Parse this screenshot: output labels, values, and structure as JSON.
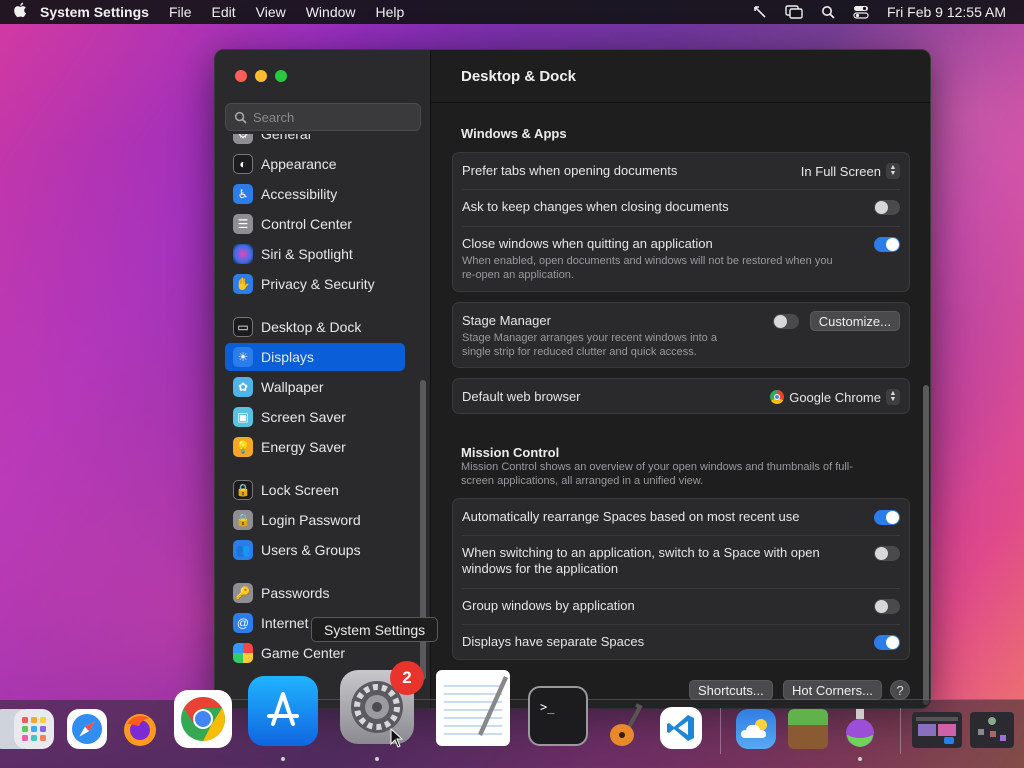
{
  "menubar": {
    "app_name": "System Settings",
    "menus": [
      "File",
      "Edit",
      "View",
      "Window",
      "Help"
    ],
    "clock": "Fri Feb 9  12:55 AM"
  },
  "window": {
    "title": "Desktop & Dock",
    "search_placeholder": "Search"
  },
  "sidebar": {
    "items": [
      {
        "label": "General",
        "icon": "gear-icon",
        "color": "#8e8e93"
      },
      {
        "label": "Appearance",
        "icon": "appearance-icon",
        "color": "#1c1c1e"
      },
      {
        "label": "Accessibility",
        "icon": "accessibility-icon",
        "color": "#2b7de9"
      },
      {
        "label": "Control Center",
        "icon": "control-center-icon",
        "color": "#8e8e93"
      },
      {
        "label": "Siri & Spotlight",
        "icon": "siri-icon",
        "color": "#7a3cc9"
      },
      {
        "label": "Privacy & Security",
        "icon": "hand-icon",
        "color": "#2b7de9"
      },
      {
        "label": "Desktop & Dock",
        "icon": "dock-icon",
        "color": "#1c1c1e"
      },
      {
        "label": "Displays",
        "icon": "sun-icon",
        "color": "#2b7de9"
      },
      {
        "label": "Wallpaper",
        "icon": "flower-icon",
        "color": "#4fb3e8"
      },
      {
        "label": "Screen Saver",
        "icon": "screen-saver-icon",
        "color": "#58c3e0"
      },
      {
        "label": "Energy Saver",
        "icon": "bulb-icon",
        "color": "#f5a623"
      },
      {
        "label": "Lock Screen",
        "icon": "lock-icon",
        "color": "#1c1c1e"
      },
      {
        "label": "Login Password",
        "icon": "lock-icon",
        "color": "#8e8e93"
      },
      {
        "label": "Users & Groups",
        "icon": "users-icon",
        "color": "#2b7de9"
      },
      {
        "label": "Passwords",
        "icon": "key-icon",
        "color": "#8e8e93"
      },
      {
        "label": "Internet",
        "icon": "at-icon",
        "color": "#2b7de9"
      },
      {
        "label": "Game Center",
        "icon": "game-center-icon",
        "color": "#e8e8e8"
      }
    ],
    "active": "Displays"
  },
  "content": {
    "windows_apps": {
      "title": "Windows & Apps",
      "prefer_tabs_label": "Prefer tabs when opening documents",
      "prefer_tabs_value": "In Full Screen",
      "ask_keep_label": "Ask to keep changes when closing documents",
      "ask_keep_on": false,
      "close_windows_label": "Close windows when quitting an application",
      "close_windows_desc_1": "When enabled, open documents and windows will not be restored when you",
      "close_windows_desc_2": "re-open an application.",
      "close_windows_on": true
    },
    "stage_manager": {
      "label": "Stage Manager",
      "desc_1": "Stage Manager arranges your recent windows into a",
      "desc_2": "single strip for reduced clutter and quick access.",
      "on": false,
      "customize_label": "Customize..."
    },
    "browser": {
      "label": "Default web browser",
      "value": "Google Chrome"
    },
    "mission_control": {
      "title": "Mission Control",
      "desc_1": "Mission Control shows an overview of your open windows and thumbnails of full-",
      "desc_2": "screen applications, all arranged in a unified view.",
      "auto_rearrange_label": "Automatically rearrange Spaces based on most recent use",
      "auto_rearrange_on": true,
      "switch_space_label_1": "When switching to an application, switch to a Space with open",
      "switch_space_label_2": "windows for the application",
      "switch_space_on": false,
      "group_windows_label": "Group windows by application",
      "group_windows_on": false,
      "separate_spaces_label": "Displays have separate Spaces",
      "separate_spaces_on": true
    },
    "buttons": {
      "shortcuts": "Shortcuts...",
      "hot_corners": "Hot Corners...",
      "help": "?"
    }
  },
  "tooltip": "System Settings",
  "dock": {
    "badge": "2",
    "apps": [
      "Launchpad",
      "Safari",
      "Firefox",
      "Google Chrome",
      "App Store",
      "System Settings",
      "TextEdit",
      "Terminal",
      "GarageBand",
      "Visual Studio Code",
      "Weather",
      "Minecraft",
      "Potion"
    ]
  }
}
